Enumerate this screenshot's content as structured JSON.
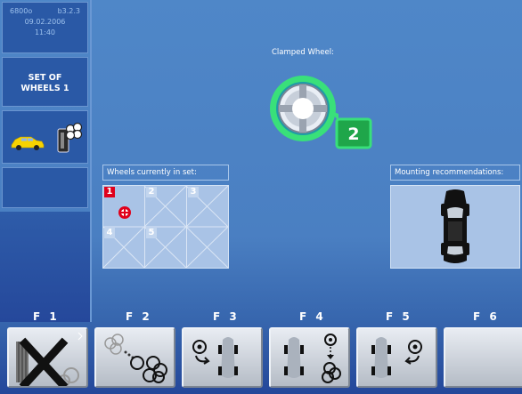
{
  "device": {
    "model": "6800o",
    "version": "b3.2.3",
    "date": "09.02.2006",
    "time": "11:40"
  },
  "sidebar": {
    "title_line1": "SET OF",
    "title_line2": "WHEELS 1"
  },
  "clamped": {
    "label": "Clamped Wheel:",
    "wheel_number": "2"
  },
  "wheel_set": {
    "header": "Wheels currently in set:",
    "cells": [
      "1",
      "2",
      "3",
      "4",
      "5"
    ],
    "active": "1"
  },
  "mounting": {
    "header": "Mounting recommendations:"
  },
  "function_keys": [
    {
      "label": "F 1",
      "icon": "cancel-icon"
    },
    {
      "label": "F 2",
      "icon": "wheel-set-icon"
    },
    {
      "label": "F 3",
      "icon": "rotate-wheel-icon"
    },
    {
      "label": "F 4",
      "icon": "swap-wheels-icon"
    },
    {
      "label": "F 5",
      "icon": "rotate-back-icon"
    },
    {
      "label": "F 6",
      "icon": ""
    }
  ],
  "colors": {
    "background": "#4a7fc2",
    "active_red": "#e0001b",
    "wheel_green": "#39e07a"
  }
}
